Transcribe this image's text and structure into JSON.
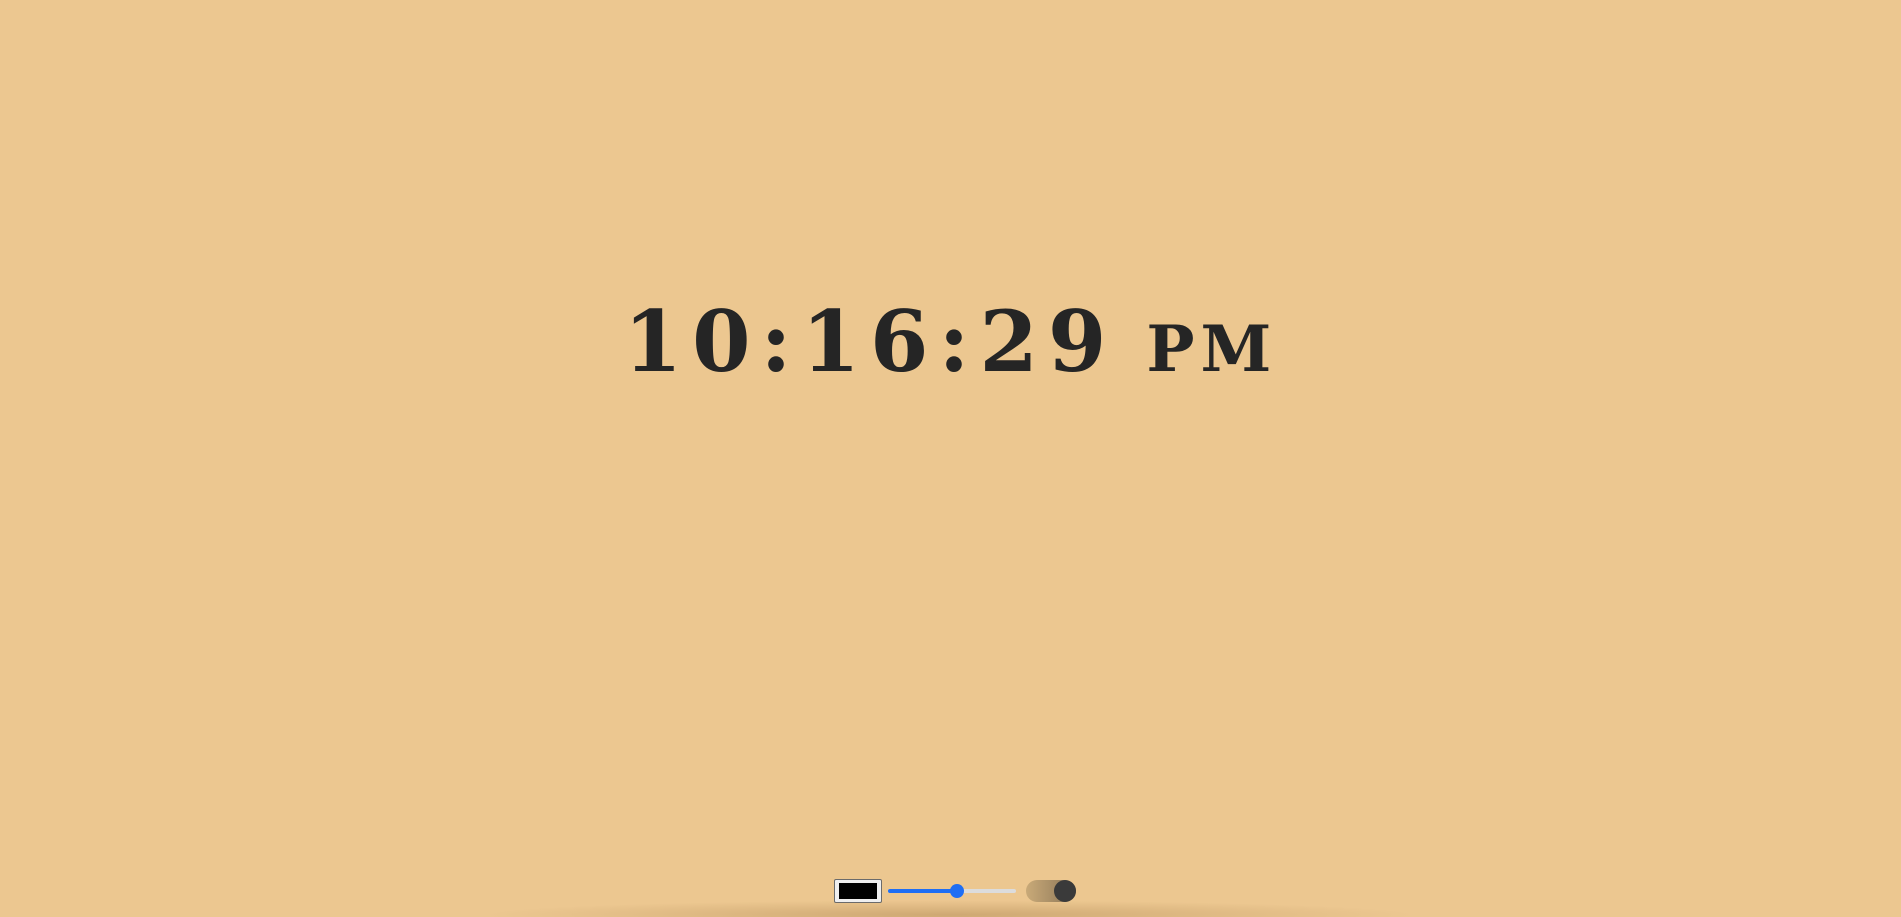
{
  "clock": {
    "time": "10:16:29",
    "ampm": "PM",
    "text_color": "#252525"
  },
  "background_color": "#ecc790",
  "controls": {
    "color_picker": {
      "value": "#000000",
      "icon": "color-swatch-icon"
    },
    "size_slider": {
      "value_fraction": 0.54,
      "accent": "#1f6ef3"
    },
    "theme_toggle": {
      "state": "on"
    }
  }
}
